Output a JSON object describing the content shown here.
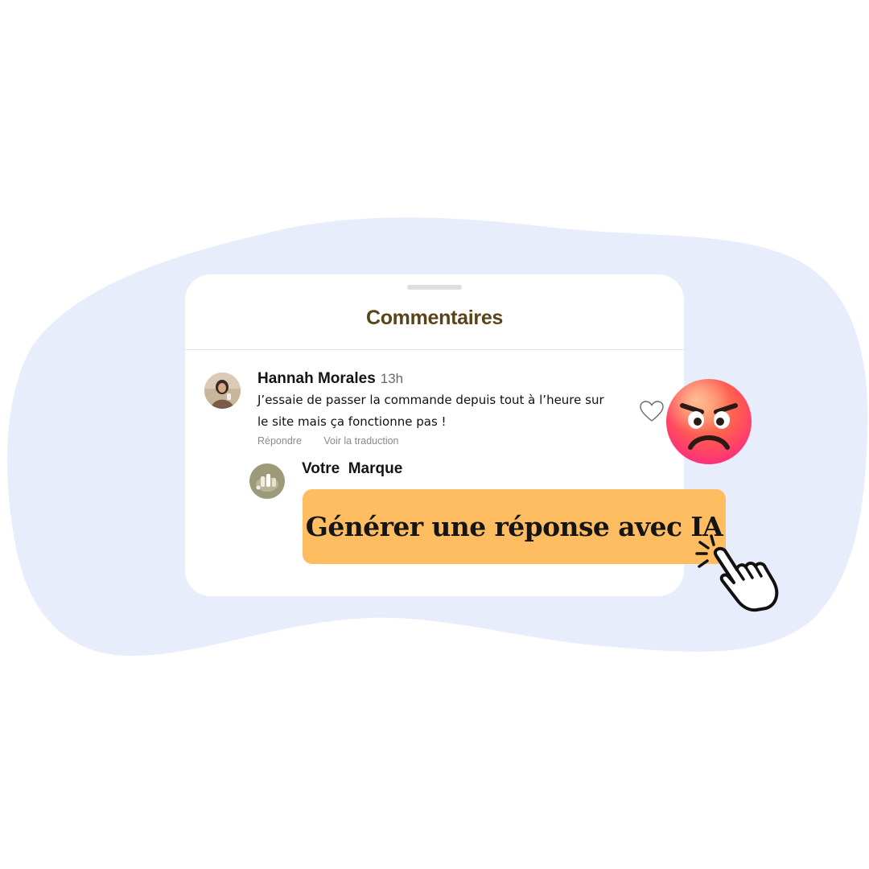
{
  "panel": {
    "title": "Commentaires"
  },
  "comment": {
    "author": "Hannah Morales",
    "time": "13h",
    "text": "J’essaie de passer la commande depuis tout à l’heure sur le site mais ça fonctionne pas !",
    "reply_label": "Répondre",
    "translate_label": "Voir la traduction"
  },
  "reply": {
    "author": "Votre  Marque"
  },
  "cta": {
    "label": "Générer une réponse avec IA"
  },
  "colors": {
    "background_blob": "#e8edfc",
    "button": "#fdbd60",
    "title": "#5a4417"
  },
  "icons": {
    "like": "heart-outline-icon",
    "emotion": "angry-face-emoji",
    "pointer": "pointing-hand-click-icon"
  }
}
